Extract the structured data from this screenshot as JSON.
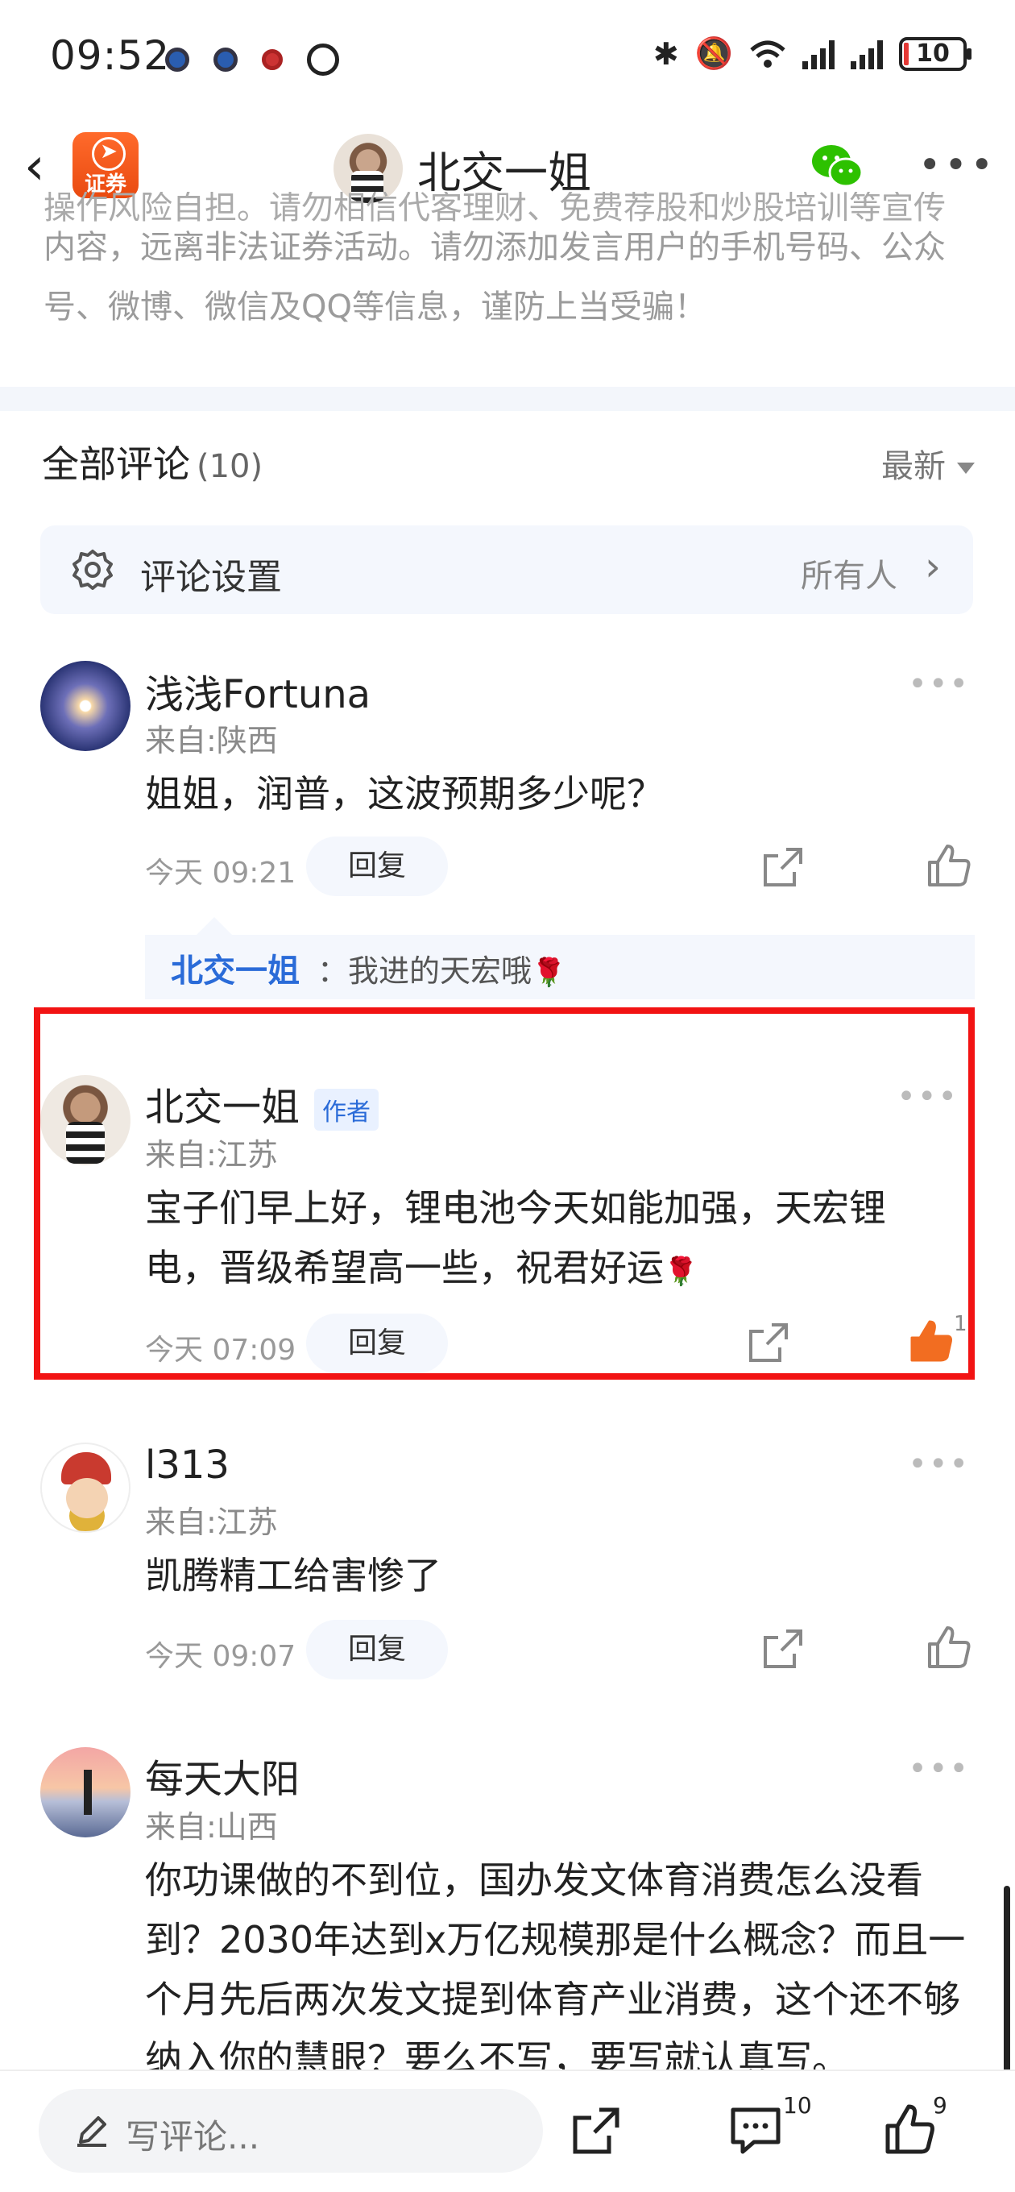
{
  "status_bar": {
    "time": "09:52",
    "battery": "10",
    "icons": [
      "notification-dot-icon",
      "notification-dot-icon",
      "notification-dot-icon",
      "alarm-icon",
      "bluetooth-icon",
      "mute-icon",
      "wifi-icon",
      "signal-icon",
      "signal-icon",
      "battery-icon"
    ]
  },
  "header": {
    "app_badge": "证券",
    "title": "北交一姐",
    "icons": [
      "back-icon",
      "wechat-icon",
      "more-icon"
    ]
  },
  "notice": {
    "top_clip": "操作风险自担。请勿相信代客理财、免费荐股和炒股培训等宣传",
    "text": "内容，远离非法证券活动。请勿添加发言用户的手机号码、公众号、微博、微信及QQ等信息，谨防上当受骗！"
  },
  "comments_section": {
    "title": "全部评论",
    "count": "(10)",
    "sort": "最新",
    "settings_label": "评论设置",
    "settings_value": "所有人"
  },
  "comments": [
    {
      "name": "浅浅Fortuna",
      "location": "来自:陕西",
      "text": "姐姐，润普，这波预期多少呢？",
      "time": "今天 09:21",
      "reply_label": "回复",
      "reply": {
        "author": "北交一姐",
        "text": "：我进的天宏哦"
      }
    },
    {
      "name": "北交一姐",
      "tag": "作者",
      "location": "来自:江苏",
      "text": "宝子们早上好，锂电池今天如能加强，天宏锂电，晋级希望高一些，祝君好运",
      "time": "今天 07:09",
      "reply_label": "回复",
      "like_count": "1",
      "liked_color": "#f26d21"
    },
    {
      "name": "l313",
      "location": "来自:江苏",
      "text": "凯腾精工给害惨了",
      "time": "今天 09:07",
      "reply_label": "回复"
    },
    {
      "name": "每天大阳",
      "location": "来自:山西",
      "text": "你功课做的不到位，国办发文体育消费怎么没看到？2030年达到x万亿规模那是什么概念？而且一个月先后两次发文提到体育产业消费，这个还不够纳入你的慧眼？要么不写，要写就认真写。"
    }
  ],
  "bottom_bar": {
    "write_placeholder": "写评论...",
    "comment_count": "10",
    "like_count": "9"
  },
  "colors": {
    "highlight": "#f21313",
    "link_blue": "#2a6bd8",
    "app_orange": "#e94a10",
    "wechat_green": "#2dc100"
  }
}
